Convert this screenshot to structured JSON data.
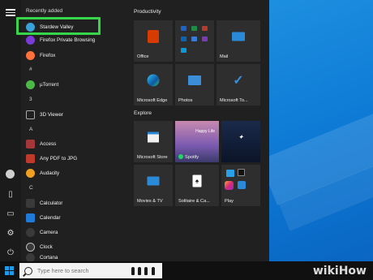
{
  "start_menu": {
    "recently_added_heading": "Recently added",
    "apps": [
      {
        "label": "Stardew Valley",
        "icon": "stardew-valley-icon",
        "color": "#3aa0d8"
      },
      {
        "label": "Firefox Private Browsing",
        "icon": "firefox-private-icon",
        "color": "#7a3bd6"
      },
      {
        "label": "Firefox",
        "icon": "firefox-icon",
        "color": "#ff7139"
      },
      {
        "label": "µTorrent",
        "icon": "utorrent-icon",
        "color": "#4cb848"
      },
      {
        "label": "3D Viewer",
        "icon": "3d-viewer-icon",
        "color": "#888888"
      },
      {
        "label": "Access",
        "icon": "access-icon",
        "color": "#a4373a"
      },
      {
        "label": "Any PDF to JPG",
        "icon": "pdf-jpg-icon",
        "color": "#c03a2b"
      },
      {
        "label": "Audacity",
        "icon": "audacity-icon",
        "color": "#f0a020"
      },
      {
        "label": "Calculator",
        "icon": "calculator-icon",
        "color": "#3a3a3a"
      },
      {
        "label": "Calendar",
        "icon": "calendar-icon",
        "color": "#1f7ad8"
      },
      {
        "label": "Camera",
        "icon": "camera-icon",
        "color": "#3a3a3a"
      },
      {
        "label": "Clock",
        "icon": "clock-icon",
        "color": "#3a3a3a"
      },
      {
        "label": "Cortana",
        "icon": "cortana-icon",
        "color": "#3a3a3a"
      }
    ],
    "letters": {
      "hash": "#",
      "a": "A",
      "c": "C"
    }
  },
  "tiles": {
    "productivity_title": "Productivity",
    "explore_title": "Explore",
    "items": [
      {
        "label": "Office",
        "icon": "office-icon"
      },
      {
        "label": "",
        "icon": "office-apps-icon"
      },
      {
        "label": "Mail",
        "icon": "mail-icon"
      },
      {
        "label": "Microsoft Edge",
        "icon": "edge-icon"
      },
      {
        "label": "Photos",
        "icon": "photos-icon"
      },
      {
        "label": "Microsoft To...",
        "icon": "todo-icon"
      },
      {
        "label": "Microsoft Store",
        "icon": "store-icon"
      },
      {
        "label": "Spotify",
        "icon": "spotify-icon"
      },
      {
        "label": "",
        "icon": "disney-icon"
      },
      {
        "label": "Movies & TV",
        "icon": "movies-icon"
      },
      {
        "label": "Solitaire & Ca...",
        "icon": "solitaire-icon"
      },
      {
        "label": "Play",
        "icon": "play-icon"
      }
    ],
    "spotify_caption": "Happy Life"
  },
  "taskbar": {
    "search_placeholder": "Type here to search"
  },
  "watermark": "wikiHow",
  "colors": {
    "highlight": "#37d64a",
    "accent": "#1e9be6"
  }
}
